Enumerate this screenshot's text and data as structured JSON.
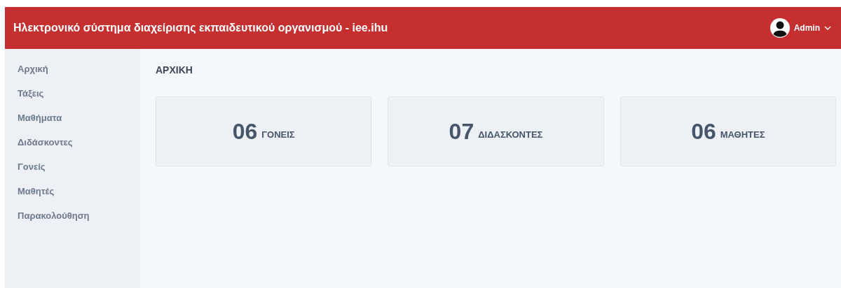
{
  "header": {
    "title": "Ηλεκτρονικό σύστημα διαχείρισης εκπαιδευτικού οργανισμού - iee.ihu",
    "user": "Admin"
  },
  "sidebar": {
    "items": [
      {
        "label": "Αρχική"
      },
      {
        "label": "Τάξεις"
      },
      {
        "label": "Μαθήματα"
      },
      {
        "label": "Διδάσκοντες"
      },
      {
        "label": "Γονείς"
      },
      {
        "label": "Μαθητές"
      },
      {
        "label": "Παρακολούθηση"
      }
    ]
  },
  "page_title": "ΑΡΧΙΚΗ",
  "stats": [
    {
      "count": "06",
      "label": "ΓΟΝΕΙΣ"
    },
    {
      "count": "07",
      "label": "ΔΙΔΑΣΚΟΝΤΕΣ"
    },
    {
      "count": "06",
      "label": "ΜΑΘΗΤΕΣ"
    }
  ]
}
